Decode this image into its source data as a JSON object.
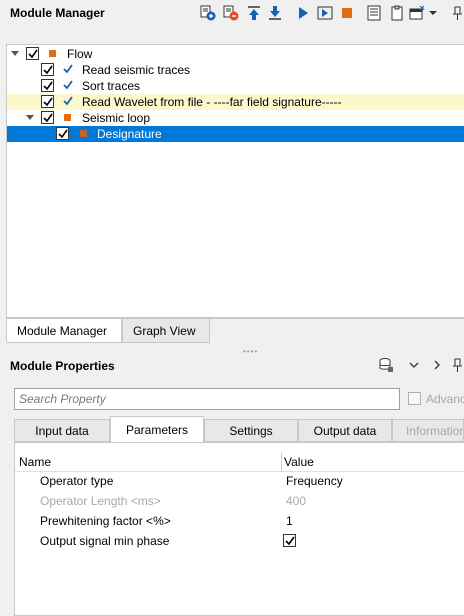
{
  "module_manager": {
    "title": "Module Manager",
    "toolbar_icons": [
      "add-module-icon",
      "remove-module-icon",
      "move-up-icon",
      "move-down-icon",
      "run-icon",
      "run-step-icon",
      "stop-icon",
      "document-icon",
      "clipboard-icon",
      "window-icon",
      "dropdown-icon",
      "pin-icon"
    ]
  },
  "tree": {
    "items": [
      {
        "label": "Flow",
        "checked": true,
        "expanded": true,
        "marker": "square",
        "level": 0
      },
      {
        "label": "Read seismic traces",
        "checked": true,
        "marker": "check",
        "level": 1
      },
      {
        "label": "Sort traces",
        "checked": true,
        "marker": "check",
        "level": 1
      },
      {
        "label": "Read Wavelet from file - ----far field signature-----",
        "checked": true,
        "marker": "check",
        "level": 1,
        "highlighted": true
      },
      {
        "label": "Seismic loop",
        "checked": true,
        "expanded": true,
        "marker": "square",
        "level": 1
      },
      {
        "label": "Designature",
        "checked": true,
        "marker": "square",
        "level": 2,
        "selected": true
      }
    ]
  },
  "tree_tabs": [
    {
      "label": "Module Manager",
      "active": true
    },
    {
      "label": "Graph View",
      "active": false
    }
  ],
  "module_properties": {
    "title": "Module Properties",
    "search_placeholder": "Search Property",
    "advanced_label": "Advanc"
  },
  "property_tabs": [
    {
      "label": "Input data",
      "active": false
    },
    {
      "label": "Parameters",
      "active": true
    },
    {
      "label": "Settings",
      "active": false
    },
    {
      "label": "Output data",
      "active": false
    },
    {
      "label": "Information",
      "active": false,
      "disabled": true
    }
  ],
  "properties": {
    "header_name": "Name",
    "header_value": "Value",
    "rows": [
      {
        "name": "Operator type",
        "value": "Frequency"
      },
      {
        "name": "Operator Length <ms>",
        "value": "400",
        "disabled": true
      },
      {
        "name": "Prewhitening factor <%>",
        "value": "1"
      },
      {
        "name": "Output signal min phase",
        "value": "",
        "checkbox": true,
        "checked": true
      }
    ]
  },
  "colors": {
    "selection": "#0078d7",
    "highlight_row": "#fdf8cc",
    "orange_marker": "#e06c14",
    "blue_check": "#1a5fb4"
  }
}
